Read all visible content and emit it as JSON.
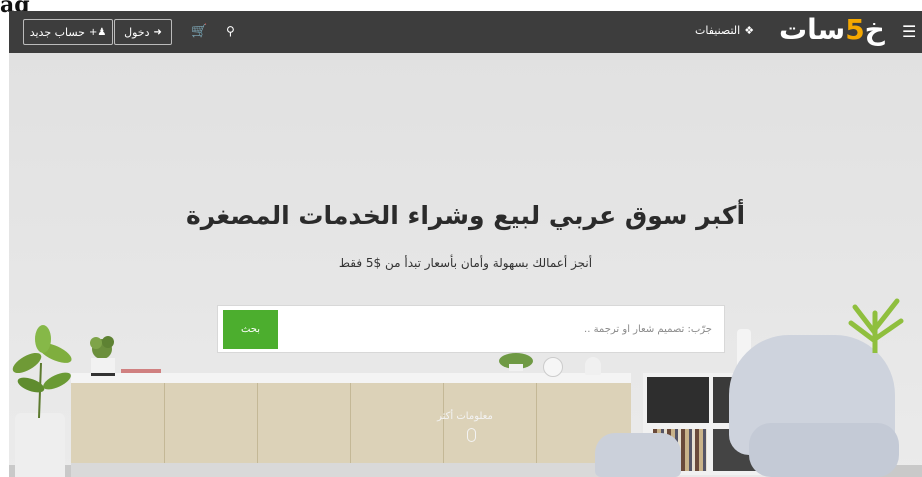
{
  "page_corner_text": "ag",
  "colors": {
    "nav_bg": "#3d3d3d",
    "accent_green": "#4cae2e",
    "logo_accent": "#f5a800"
  },
  "nav": {
    "register_label": "حساب جديد",
    "login_label": "دخول",
    "categories_label": "التصنيفات",
    "logo_text_pre": "خ",
    "logo_digit": "5",
    "logo_text_post": "سات",
    "icons": {
      "register": "user-plus-icon",
      "login": "sign-in-icon",
      "cart": "shopping-cart-icon",
      "search": "search-icon",
      "categories": "categories-icon",
      "menu": "hamburger-menu-icon"
    }
  },
  "hero": {
    "headline": "أكبر سوق عربي لبيع وشراء الخدمات المصغرة",
    "subheadline": "أنجز أعمالك بسهولة وأمان بأسعار تبدأ من $5 فقط",
    "search_placeholder": "جرّب: تصميم شعار أو ترجمة ..",
    "search_button": "بحث",
    "more_info": "معلومات أكثر",
    "more_info_icon": "mouse-scroll-icon"
  }
}
